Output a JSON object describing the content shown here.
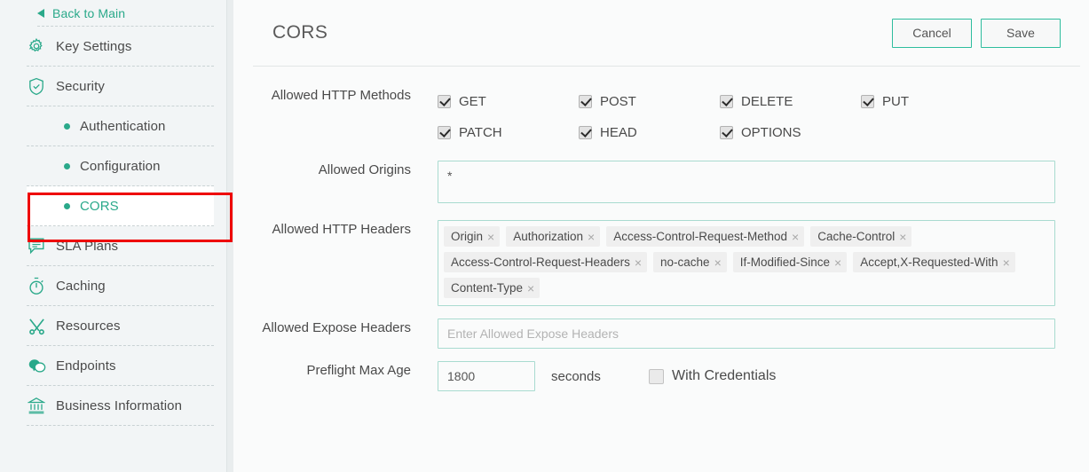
{
  "sidebar": {
    "back": {
      "label": "Back to Main",
      "icon": "caret-left-icon"
    },
    "items": [
      {
        "label": "Key Settings",
        "icon": "gear-icon",
        "type": "main",
        "active": false
      },
      {
        "label": "Security",
        "icon": "shield-check-icon",
        "type": "main",
        "active": false
      },
      {
        "label": "Authentication",
        "icon": "bullet-dot-icon",
        "type": "sub",
        "active": false
      },
      {
        "label": "Configuration",
        "icon": "bullet-dot-icon",
        "type": "sub",
        "active": false
      },
      {
        "label": "CORS",
        "icon": "bullet-dot-icon",
        "type": "sub",
        "active": true
      },
      {
        "label": "SLA Plans",
        "icon": "speech-list-icon",
        "type": "main",
        "active": false
      },
      {
        "label": "Caching",
        "icon": "stopwatch-icon",
        "type": "main",
        "active": false
      },
      {
        "label": "Resources",
        "icon": "tools-icon",
        "type": "main",
        "active": false
      },
      {
        "label": "Endpoints",
        "icon": "chat-bubbles-icon",
        "type": "main",
        "active": false
      },
      {
        "label": "Business Information",
        "icon": "bank-icon",
        "type": "main",
        "active": false
      }
    ]
  },
  "header": {
    "title": "CORS",
    "cancel_label": "Cancel",
    "save_label": "Save"
  },
  "form": {
    "methods_label": "Allowed HTTP Methods",
    "methods": [
      {
        "label": "GET",
        "checked": true
      },
      {
        "label": "POST",
        "checked": true
      },
      {
        "label": "DELETE",
        "checked": true
      },
      {
        "label": "PUT",
        "checked": true
      },
      {
        "label": "PATCH",
        "checked": true
      },
      {
        "label": "HEAD",
        "checked": true
      },
      {
        "label": "OPTIONS",
        "checked": true
      }
    ],
    "origins_label": "Allowed Origins",
    "origins_value": "*",
    "headers_label": "Allowed HTTP Headers",
    "headers_tags": [
      "Origin",
      "Authorization",
      "Access-Control-Request-Method",
      "Cache-Control",
      "Access-Control-Request-Headers",
      "no-cache",
      "If-Modified-Since",
      "Accept,X-Requested-With",
      "Content-Type"
    ],
    "tag_remove_glyph": "×",
    "expose_label": "Allowed Expose Headers",
    "expose_value": "",
    "expose_placeholder": "Enter Allowed Expose Headers",
    "preflight_label": "Preflight Max Age",
    "preflight_value": "1800",
    "preflight_units": "seconds",
    "credentials_label": "With Credentials",
    "credentials_checked": false
  },
  "annotation": {
    "type": "red-highlight-box",
    "target": "CORS"
  },
  "colors": {
    "accent_teal": "#2aa98a",
    "border_teal": "#a9dbd0",
    "sidebar_bg": "#f2f5f6",
    "main_bg": "#fafbfb",
    "annotation_red": "#ee0000",
    "text": "#4a4a4a"
  }
}
